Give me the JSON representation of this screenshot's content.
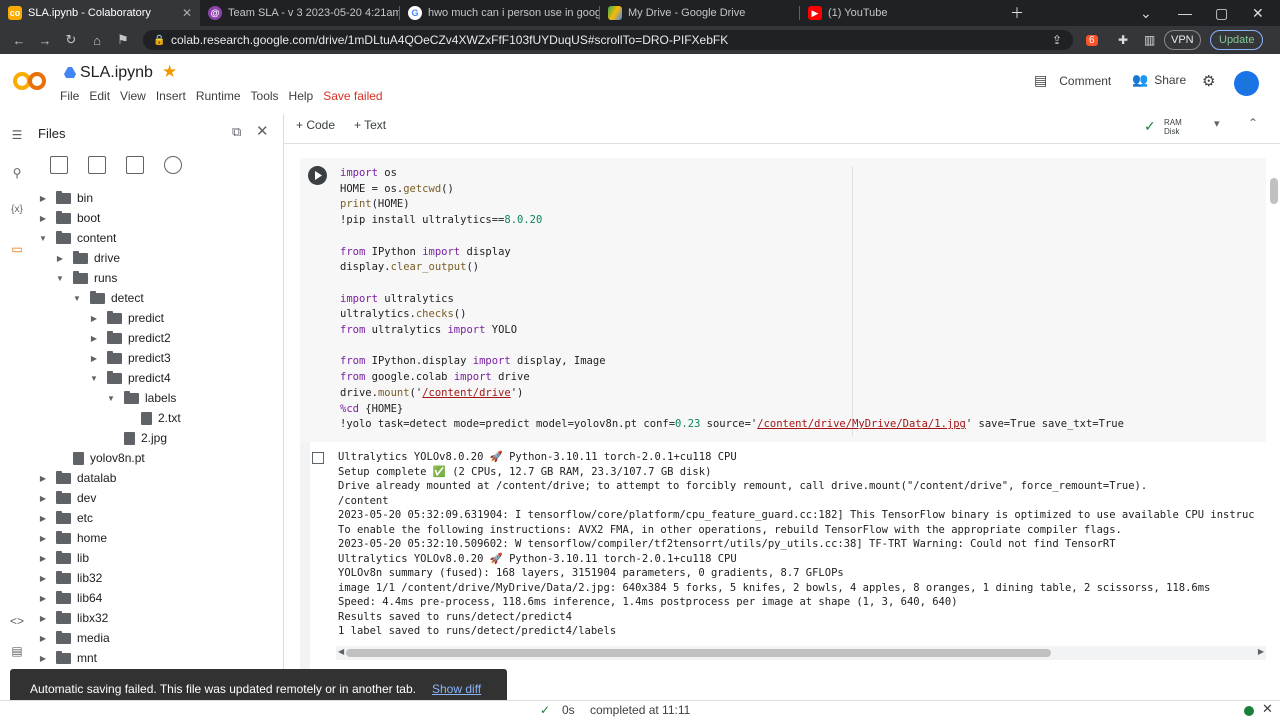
{
  "browser": {
    "tabs": [
      {
        "title": "SLA.ipynb - Colaboratory",
        "active": true,
        "icon": "colab-icon"
      },
      {
        "title": "Team SLA - v 3 2023-05-20 4:21am >",
        "active": false,
        "icon": "roboflow-icon"
      },
      {
        "title": "hwo much can i person use in google",
        "active": false,
        "icon": "google-icon"
      },
      {
        "title": "My Drive - Google Drive",
        "active": false,
        "icon": "drive-icon"
      },
      {
        "title": "(1) YouTube",
        "active": false,
        "icon": "youtube-icon"
      }
    ],
    "url": "colab.research.google.com/drive/1mDLtuA4QOeCZv4XWZxFfF103fUYDuqUS#scrollTo=DRO-PIFXebFK",
    "vpn_label": "VPN",
    "update_label": "Update",
    "brave_count": "6"
  },
  "colab": {
    "notebook_title": "SLA.ipynb",
    "menu": [
      "File",
      "Edit",
      "View",
      "Insert",
      "Runtime",
      "Tools",
      "Help"
    ],
    "save_status": "Save failed",
    "comment_label": "Comment",
    "share_label": "Share",
    "add_code_label": "+ Code",
    "add_text_label": "+ Text",
    "ram_label": "RAM",
    "disk_label": "Disk"
  },
  "files": {
    "title": "Files",
    "tree": [
      {
        "name": "bin",
        "type": "folder",
        "depth": 0,
        "expanded": false
      },
      {
        "name": "boot",
        "type": "folder",
        "depth": 0,
        "expanded": false
      },
      {
        "name": "content",
        "type": "folder",
        "depth": 0,
        "expanded": true
      },
      {
        "name": "drive",
        "type": "folder",
        "depth": 1,
        "expanded": false
      },
      {
        "name": "runs",
        "type": "folder",
        "depth": 1,
        "expanded": true
      },
      {
        "name": "detect",
        "type": "folder",
        "depth": 2,
        "expanded": true
      },
      {
        "name": "predict",
        "type": "folder",
        "depth": 3,
        "expanded": false
      },
      {
        "name": "predict2",
        "type": "folder",
        "depth": 3,
        "expanded": false
      },
      {
        "name": "predict3",
        "type": "folder",
        "depth": 3,
        "expanded": false
      },
      {
        "name": "predict4",
        "type": "folder",
        "depth": 3,
        "expanded": true
      },
      {
        "name": "labels",
        "type": "folder",
        "depth": 4,
        "expanded": true
      },
      {
        "name": "2.txt",
        "type": "file",
        "depth": 5
      },
      {
        "name": "2.jpg",
        "type": "file",
        "depth": 4
      },
      {
        "name": "yolov8n.pt",
        "type": "file",
        "depth": 1
      },
      {
        "name": "datalab",
        "type": "folder",
        "depth": 0,
        "expanded": false
      },
      {
        "name": "dev",
        "type": "folder",
        "depth": 0,
        "expanded": false
      },
      {
        "name": "etc",
        "type": "folder",
        "depth": 0,
        "expanded": false
      },
      {
        "name": "home",
        "type": "folder",
        "depth": 0,
        "expanded": false
      },
      {
        "name": "lib",
        "type": "folder",
        "depth": 0,
        "expanded": false
      },
      {
        "name": "lib32",
        "type": "folder",
        "depth": 0,
        "expanded": false
      },
      {
        "name": "lib64",
        "type": "folder",
        "depth": 0,
        "expanded": false
      },
      {
        "name": "libx32",
        "type": "folder",
        "depth": 0,
        "expanded": false
      },
      {
        "name": "media",
        "type": "folder",
        "depth": 0,
        "expanded": false
      },
      {
        "name": "mnt",
        "type": "folder",
        "depth": 0,
        "expanded": false
      }
    ]
  },
  "cell": {
    "output_lines": [
      "Ultralytics YOLOv8.0.20 🚀 Python-3.10.11 torch-2.0.1+cu118 CPU",
      "Setup complete ✅ (2 CPUs, 12.7 GB RAM, 23.3/107.7 GB disk)",
      "Drive already mounted at /content/drive; to attempt to forcibly remount, call drive.mount(\"/content/drive\", force_remount=True).",
      "/content",
      "2023-05-20 05:32:09.631904: I tensorflow/core/platform/cpu_feature_guard.cc:182] This TensorFlow binary is optimized to use available CPU instruc",
      "To enable the following instructions: AVX2 FMA, in other operations, rebuild TensorFlow with the appropriate compiler flags.",
      "2023-05-20 05:32:10.509602: W tensorflow/compiler/tf2tensorrt/utils/py_utils.cc:38] TF-TRT Warning: Could not find TensorRT",
      "Ultralytics YOLOv8.0.20 🚀 Python-3.10.11 torch-2.0.1+cu118 CPU",
      "YOLOv8n summary (fused): 168 layers, 3151904 parameters, 0 gradients, 8.7 GFLOPs",
      "image 1/1 /content/drive/MyDrive/Data/2.jpg: 640x384 5 forks, 5 knifes, 2 bowls, 4 apples, 8 oranges, 1 dining table, 2 scissorss, 118.6ms",
      "Speed: 4.4ms pre-process, 118.6ms inference, 1.4ms postprocess per image at shape (1, 3, 640, 640)",
      "Results saved to runs/detect/predict4",
      "1 label saved to runs/detect/predict4/labels"
    ]
  },
  "toast": {
    "message": "Automatic saving failed. This file was updated remotely or in another tab.",
    "action": "Show diff"
  },
  "status": {
    "duration": "0s",
    "completed": "completed at 11:11"
  }
}
